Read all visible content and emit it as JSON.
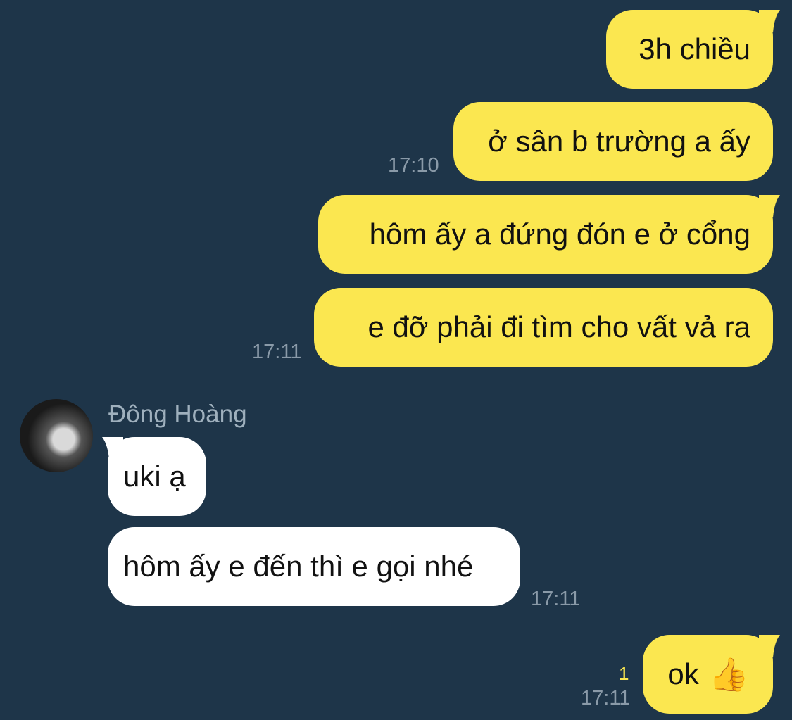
{
  "conversation": {
    "messages": [
      {
        "id": "m1",
        "direction": "outgoing",
        "text": "3h chiều"
      },
      {
        "id": "m2",
        "direction": "outgoing",
        "text": "ở sân b trường a ấy",
        "time": "17:10"
      },
      {
        "id": "m3",
        "direction": "outgoing",
        "text": "hôm ấy a đứng đón e ở cổng"
      },
      {
        "id": "m4",
        "direction": "outgoing",
        "text": "e đỡ phải đi tìm cho vất vả ra",
        "time": "17:11"
      },
      {
        "id": "m5",
        "direction": "incoming",
        "sender": "Đông Hoàng",
        "text": "uki ạ"
      },
      {
        "id": "m6",
        "direction": "incoming",
        "text": "hôm ấy e đến thì e gọi nhé",
        "time": "17:11"
      },
      {
        "id": "m7",
        "direction": "outgoing",
        "text": "ok",
        "emoji": "👍",
        "unread_count": "1",
        "time": "17:11"
      }
    ]
  },
  "colors": {
    "background": "#1e3549",
    "outgoing_bubble": "#fbe750",
    "incoming_bubble": "#ffffff",
    "timestamp": "#8a9aa8",
    "sender_name": "#9fb0bd"
  },
  "icons": {
    "thumbs_up": "thumbs-up-emoji"
  }
}
